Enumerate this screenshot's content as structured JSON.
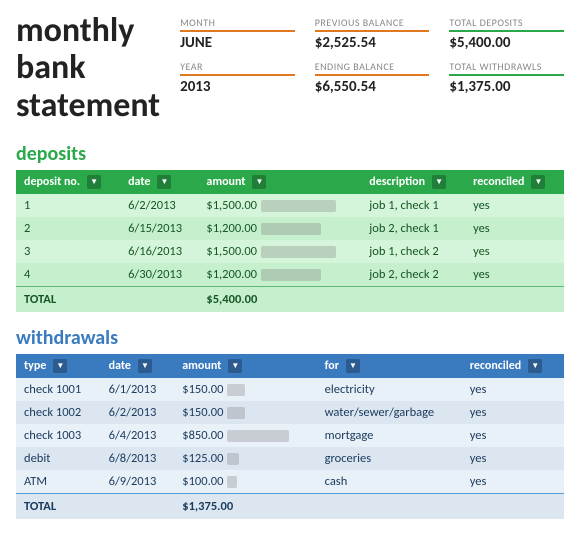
{
  "title": {
    "line1": "monthly",
    "line2": "bank",
    "line3": "statement"
  },
  "stats": {
    "month_label": "MONTH",
    "month_value": "JUNE",
    "prev_balance_label": "PREVIOUS BALANCE",
    "prev_balance_value": "$2,525.54",
    "total_deposits_label": "TOTAL DEPOSITS",
    "total_deposits_value": "$5,400.00",
    "year_label": "YEAR",
    "year_value": "2013",
    "ending_balance_label": "ENDING BALANCE",
    "ending_balance_value": "$6,550.54",
    "total_withdrawals_label": "TOTAL WITHDRAWLS",
    "total_withdrawals_value": "$1,375.00"
  },
  "deposits": {
    "section_label": "deposits",
    "columns": [
      "deposit no.",
      "date",
      "amount",
      "description",
      "reconciled"
    ],
    "rows": [
      {
        "no": "1",
        "date": "6/2/2013",
        "amount": "$1,500.00",
        "bar": 75,
        "description": "job 1, check 1",
        "reconciled": "yes"
      },
      {
        "no": "2",
        "date": "6/15/2013",
        "amount": "$1,200.00",
        "bar": 60,
        "description": "job 2, check 1",
        "reconciled": "yes"
      },
      {
        "no": "3",
        "date": "6/16/2013",
        "amount": "$1,500.00",
        "bar": 75,
        "description": "job 1, check 2",
        "reconciled": "yes"
      },
      {
        "no": "4",
        "date": "6/30/2013",
        "amount": "$1,200.00",
        "bar": 60,
        "description": "job 2, check 2",
        "reconciled": "yes"
      }
    ],
    "total_label": "TOTAL",
    "total_value": "$5,400.00"
  },
  "withdrawals": {
    "section_label": "withdrawals",
    "columns": [
      "type",
      "date",
      "amount",
      "for",
      "reconciled"
    ],
    "rows": [
      {
        "type": "check 1001",
        "date": "6/1/2013",
        "amount": "$150.00",
        "bar": 18,
        "for": "electricity",
        "reconciled": "yes"
      },
      {
        "type": "check 1002",
        "date": "6/2/2013",
        "amount": "$150.00",
        "bar": 18,
        "for": "water/sewer/garbage",
        "reconciled": "yes"
      },
      {
        "type": "check 1003",
        "date": "6/4/2013",
        "amount": "$850.00",
        "bar": 62,
        "for": "mortgage",
        "reconciled": "yes"
      },
      {
        "type": "debit",
        "date": "6/8/2013",
        "amount": "$125.00",
        "bar": 12,
        "for": "groceries",
        "reconciled": "yes"
      },
      {
        "type": "ATM",
        "date": "6/9/2013",
        "amount": "$100.00",
        "bar": 10,
        "for": "cash",
        "reconciled": "yes"
      }
    ],
    "total_label": "TOTAL",
    "total_value": "$1,375.00"
  }
}
